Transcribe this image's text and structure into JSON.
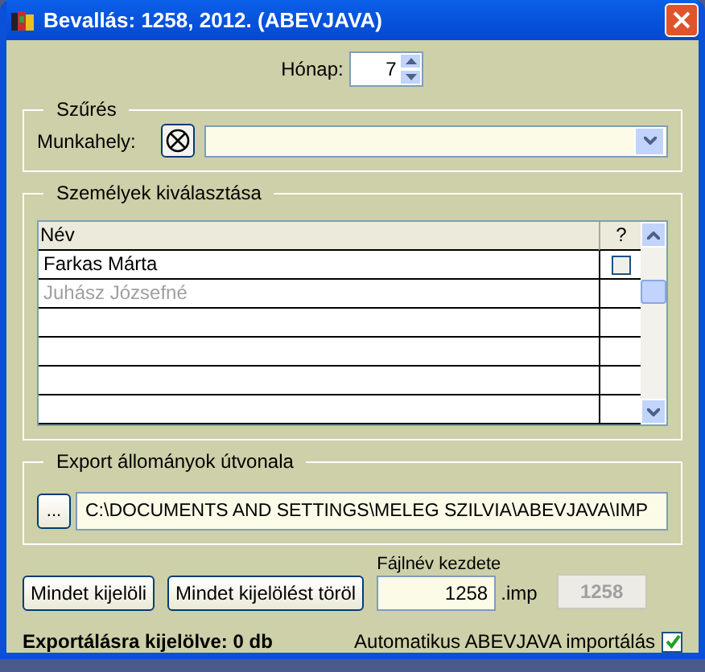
{
  "window": {
    "title": "Bevallás: 1258, 2012. (ABEVJAVA)"
  },
  "month": {
    "label": "Hónap:",
    "value": "7"
  },
  "filter": {
    "title": "Szűrés",
    "workplace_label": "Munkahely:"
  },
  "persons": {
    "title": "Személyek kiválasztása",
    "columns": [
      "Név",
      "?"
    ],
    "rows": [
      {
        "name": "Farkas Márta",
        "checked": false,
        "disabled": false
      },
      {
        "name": "Juhász Józsefné",
        "disabled": true
      }
    ]
  },
  "export": {
    "title": "Export állományok útvonala",
    "browse_label": "...",
    "path": "C:\\DOCUMENTS AND SETTINGS\\MELEG SZILVIA\\ABEVJAVA\\IMP"
  },
  "buttons": [
    "Mindet kijelöli",
    "Mindet kijelölést töröl"
  ],
  "filename": {
    "label": "Fájlnév kezdete",
    "value": "1258",
    "suffix": ".imp",
    "preview": "1258"
  },
  "status": "Exportálásra kijelölve: 0 db",
  "auto_import": {
    "label": "Automatikus ABEVJAVA importálás",
    "checked": true
  }
}
